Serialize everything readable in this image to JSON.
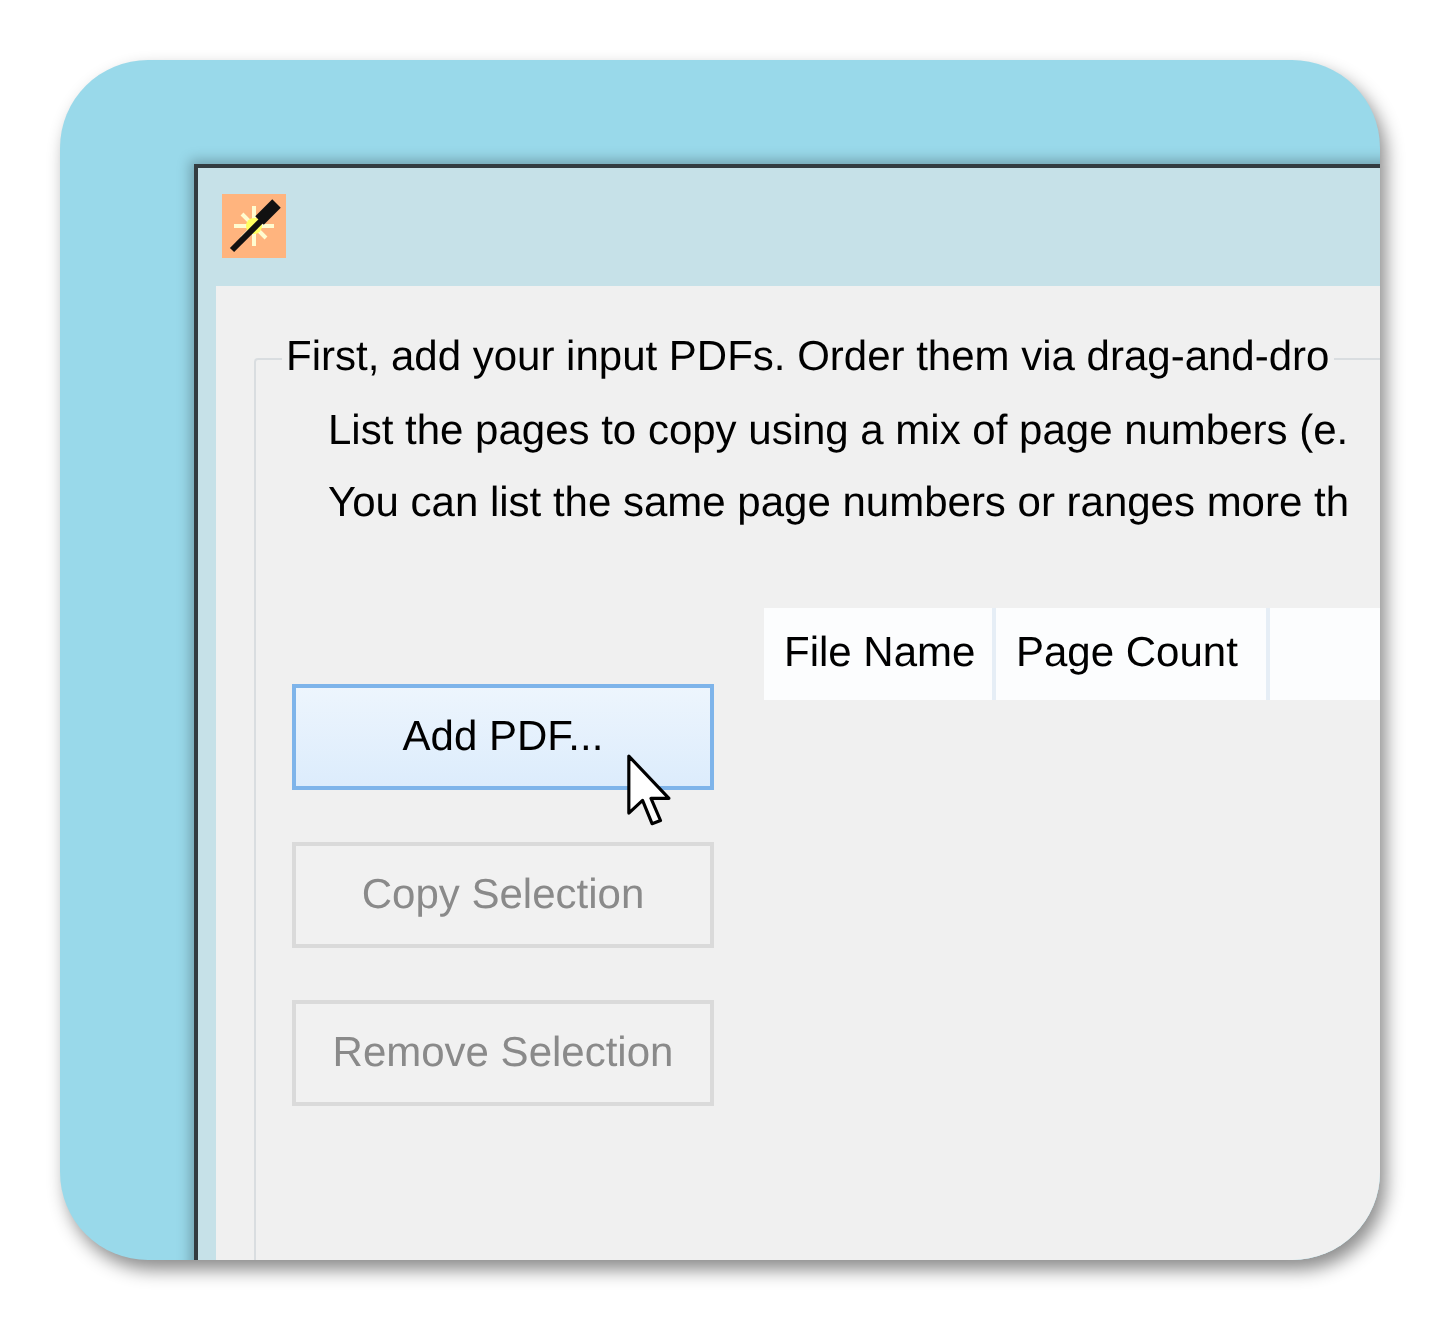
{
  "group_box": {
    "title": "First, add your input PDFs. Order them via drag-and-dro",
    "lines": [
      "List the pages to copy using a mix of page numbers (e.",
      "You can list the same page numbers or ranges more th"
    ]
  },
  "buttons": [
    {
      "label": "Add PDF...",
      "hovered": true,
      "disabled": false
    },
    {
      "label": "Copy Selection",
      "hovered": false,
      "disabled": true
    },
    {
      "label": "Remove Selection",
      "hovered": false,
      "disabled": true
    }
  ],
  "file_table": {
    "columns": [
      "File Name",
      "Page Count"
    ]
  }
}
